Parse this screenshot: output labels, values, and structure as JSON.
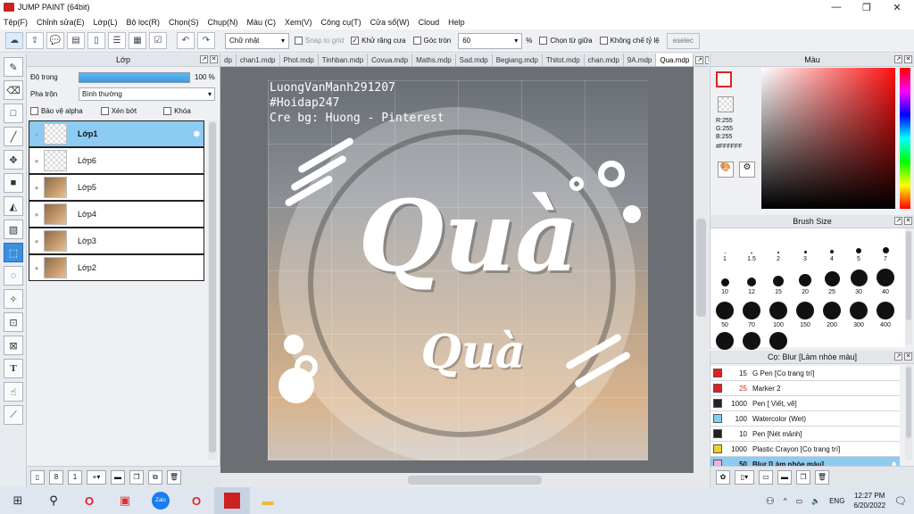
{
  "window": {
    "title": "JUMP PAINT (64bit)"
  },
  "menu": [
    "Tệp(F)",
    "Chỉnh sửa(E)",
    "Lớp(L)",
    "Bộ lọc(R)",
    "Chọn(S)",
    "Chụp(N)",
    "Màu (C)",
    "Xem(V)",
    "Công cụ(T)",
    "Cửa sổ(W)",
    "Cloud",
    "Help"
  ],
  "toolbar": {
    "shape_select": "Chữ nhật",
    "snap_grid": "Snap to grid",
    "antialias": "Khử răng cưa",
    "round_corner": "Góc tròn",
    "round_value": "60",
    "percent": "%",
    "select_center": "Chọn từ giữa",
    "fixed_ratio": "Không chế tỷ lệ",
    "deselect": "eselec"
  },
  "layer_panel": {
    "title": "Lớp",
    "opacity_label": "Độ trong",
    "opacity_value": "100 %",
    "blend_label": "Pha trộn",
    "blend_value": "Bình thường",
    "protect_alpha": "Bảo vệ alpha",
    "clip": "Xén bớt",
    "lock": "Khóa",
    "layers": [
      "Lớp1",
      "Lớp6",
      "Lớp5",
      "Lớp4",
      "Lớp3",
      "Lớp2"
    ]
  },
  "tabs": [
    "dp",
    "chan1.mdp",
    "Phot.mdp",
    "Tinhban.mdp",
    "Covua.mdp",
    "Maths.mdp",
    "Sad.mdp",
    "Begiang.mdp",
    "Thitot.mdp",
    "chan.mdp",
    "9A.mdp",
    "Qua.mdp"
  ],
  "artwork": {
    "line1": "LuongVanManh291207",
    "line2": "#Hoidap247",
    "line3": "Cre bg: Huong - Pinterest",
    "big_word": "Quà",
    "small_word": "Quà"
  },
  "color_panel": {
    "title": "Màu",
    "r": "R:255",
    "g": "G:255",
    "b": "B:255",
    "hex": "#FFFFFF"
  },
  "brush_size_panel": {
    "title": "Brush Size",
    "sizes": [
      "1",
      "1.5",
      "2",
      "3",
      "4",
      "5",
      "7",
      "10",
      "12",
      "15",
      "20",
      "25",
      "30",
      "40",
      "50",
      "70",
      "100",
      "150",
      "200",
      "300",
      "400"
    ]
  },
  "brush_panel": {
    "title": "Cọ: Blur [Làm nhòe màu]",
    "items": [
      {
        "num": "15",
        "name": "G Pen [Cọ trang trí]",
        "color": "#e02020"
      },
      {
        "num": "25",
        "name": "Marker 2",
        "color": "#e02020"
      },
      {
        "num": "1000",
        "name": "Pen [ Viết, vẽ]",
        "color": "#222222"
      },
      {
        "num": "100",
        "name": "Watercolor (Wet)",
        "color": "#7fd0f0"
      },
      {
        "num": "10",
        "name": "Pen [Nét mảnh]",
        "color": "#222222"
      },
      {
        "num": "1000",
        "name": "Plastic Crayon [Cọ trang trí]",
        "color": "#f0d020"
      },
      {
        "num": "50",
        "name": "Blur [Làm nhòe màu]",
        "color": "#f0b0e0"
      }
    ]
  },
  "taskbar": {
    "time": "12:27 PM",
    "date": "6/20/2022",
    "lang": "ENG"
  }
}
